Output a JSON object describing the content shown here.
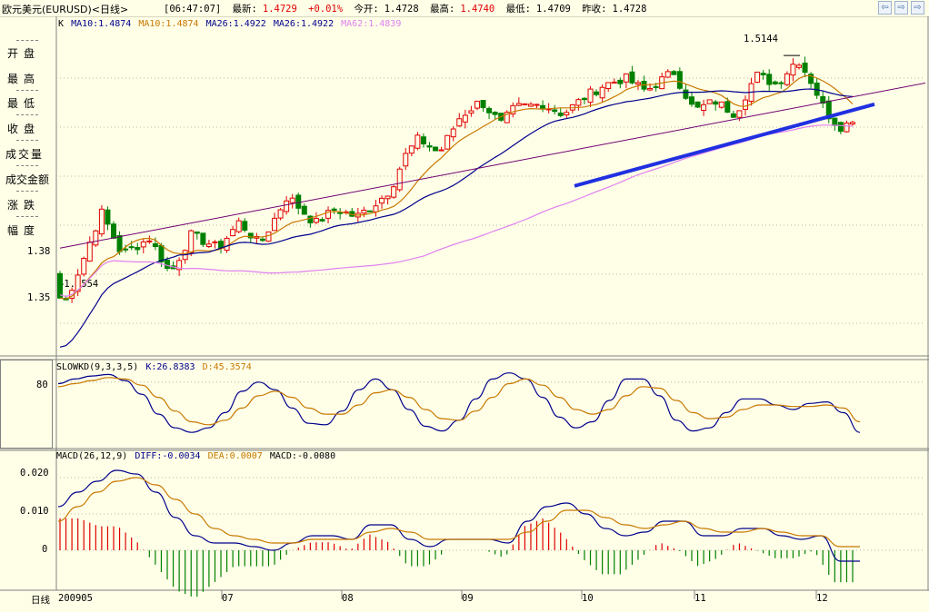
{
  "window": {
    "title": "欧元美元(EURUSD)<日线>",
    "nav_prev": "⇦",
    "nav_next": "⇨",
    "nav_right": "⇨"
  },
  "quote": {
    "time": "[06:47:07]",
    "last_label": "最新:",
    "last": "1.4729",
    "change": "+0.01%",
    "open_label": "今开:",
    "open": "1.4728",
    "high_label": "最高:",
    "high": "1.4740",
    "low_label": "最低:",
    "low": "1.4709",
    "prev_label": "昨收:",
    "prev": "1.4728"
  },
  "left_panel": [
    "开盘",
    "最高",
    "最低",
    "收盘",
    "成交量",
    "成交金额",
    "涨跌",
    "幅度"
  ],
  "bottom_axis_label": "日线",
  "colors": {
    "up": "#e00000",
    "down": "#008000",
    "ma10": "#c87800",
    "ma26": "#00008c",
    "ma62": "#e080f0",
    "trend": "#2030e0"
  },
  "chart_data": [
    {
      "type": "candlestick",
      "legend": [
        {
          "text": "K",
          "color": "#000000"
        },
        {
          "text": "MA10:1.4874",
          "color": "#00008c"
        },
        {
          "text": "MA10:1.4874",
          "color": "#c87800"
        },
        {
          "text": "MA26:1.4922",
          "color": "#00008c"
        },
        {
          "text": "MA26:1.4922",
          "color": "#00008c"
        },
        {
          "text": "MA62:1.4839",
          "color": "#e080f0"
        }
      ],
      "y_ticks": [
        "1.38",
        "1.35"
      ],
      "ylim": [
        1.33,
        1.53
      ],
      "annotations": [
        {
          "text": "1.5144",
          "at_value": 1.5144
        },
        {
          "text": "←1.3554",
          "at_value": 1.3554
        }
      ],
      "x_ticks": [
        "200905",
        "07",
        "08",
        "09",
        "10",
        "11",
        "12"
      ],
      "start_close": 1.3554,
      "end_close": 1.4729,
      "peak": 1.5144
    },
    {
      "type": "line",
      "legend": [
        {
          "text": "SLOWKD(9,3,3,5)",
          "color": "#000000"
        },
        {
          "text": "K:26.8383",
          "color": "#00008c"
        },
        {
          "text": "D:45.3574",
          "color": "#c87800"
        }
      ],
      "y_ticks": [
        "80"
      ],
      "ylim": [
        0,
        100
      ],
      "k_keypoints": [
        78,
        84,
        88,
        90,
        82,
        64,
        38,
        20,
        14,
        20,
        40,
        68,
        80,
        70,
        46,
        26,
        24,
        42,
        70,
        84,
        70,
        44,
        22,
        16,
        30,
        58,
        84,
        92,
        84,
        60,
        34,
        20,
        28,
        56,
        84,
        84,
        62,
        30,
        16,
        20,
        40,
        58,
        58,
        50,
        44,
        52,
        54,
        40,
        14
      ],
      "d_keypoints": [
        74,
        78,
        82,
        86,
        84,
        76,
        60,
        42,
        28,
        24,
        30,
        46,
        62,
        68,
        60,
        46,
        38,
        38,
        50,
        66,
        70,
        60,
        44,
        32,
        30,
        42,
        60,
        78,
        84,
        76,
        60,
        44,
        38,
        44,
        62,
        74,
        72,
        56,
        40,
        32,
        34,
        44,
        50,
        50,
        48,
        48,
        50,
        46,
        28
      ]
    },
    {
      "type": "bar_line",
      "legend": [
        {
          "text": "MACD(26,12,9)",
          "color": "#000000"
        },
        {
          "text": "DIFF:-0.0034",
          "color": "#00008c"
        },
        {
          "text": "DEA:0.0007",
          "color": "#c87800"
        },
        {
          "text": "MACD:-0.0080",
          "color": "#000000"
        }
      ],
      "y_ticks": [
        "0.020",
        "0.010",
        "0"
      ],
      "ylim": [
        -0.011,
        0.024
      ],
      "diff_keypoints": [
        0.012,
        0.016,
        0.019,
        0.022,
        0.021,
        0.016,
        0.009,
        0.004,
        0.002,
        0.002,
        0.001,
        0.0,
        0.002,
        0.004,
        0.004,
        0.003,
        0.007,
        0.007,
        0.003,
        0.001,
        0.003,
        0.003,
        0.003,
        0.002,
        0.008,
        0.012,
        0.013,
        0.01,
        0.006,
        0.004,
        0.005,
        0.008,
        0.008,
        0.004,
        0.004,
        0.006,
        0.006,
        0.004,
        0.003,
        0.004,
        -0.003,
        -0.003
      ],
      "dea_keypoints": [
        0.008,
        0.012,
        0.016,
        0.019,
        0.02,
        0.018,
        0.014,
        0.01,
        0.006,
        0.004,
        0.003,
        0.002,
        0.002,
        0.003,
        0.003,
        0.003,
        0.005,
        0.006,
        0.005,
        0.003,
        0.003,
        0.003,
        0.003,
        0.003,
        0.005,
        0.008,
        0.011,
        0.011,
        0.009,
        0.007,
        0.006,
        0.007,
        0.008,
        0.006,
        0.005,
        0.005,
        0.006,
        0.005,
        0.004,
        0.004,
        0.001,
        0.001
      ]
    }
  ]
}
